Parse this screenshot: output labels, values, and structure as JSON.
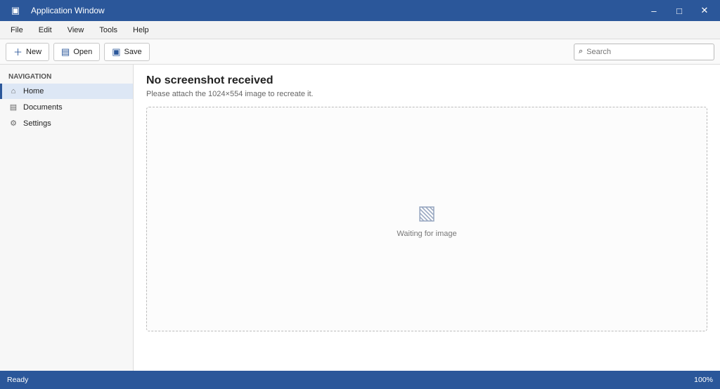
{
  "window": {
    "title": "Application Window"
  },
  "menu": {
    "items": [
      "File",
      "Edit",
      "View",
      "Tools",
      "Help"
    ]
  },
  "toolbar": {
    "new_label": "New",
    "open_label": "Open",
    "save_label": "Save",
    "search_placeholder": "Search"
  },
  "sidebar": {
    "heading": "Navigation",
    "items": [
      {
        "label": "Home",
        "icon": "home-icon"
      },
      {
        "label": "Documents",
        "icon": "folder-icon"
      },
      {
        "label": "Settings",
        "icon": "gear-icon"
      }
    ]
  },
  "main": {
    "title": "No screenshot received",
    "subtitle": "Please attach the 1024×554 image to recreate it.",
    "empty_text": "Waiting for image"
  },
  "status": {
    "left": "Ready",
    "right": "100%"
  },
  "colors": {
    "accent": "#2b579a"
  }
}
